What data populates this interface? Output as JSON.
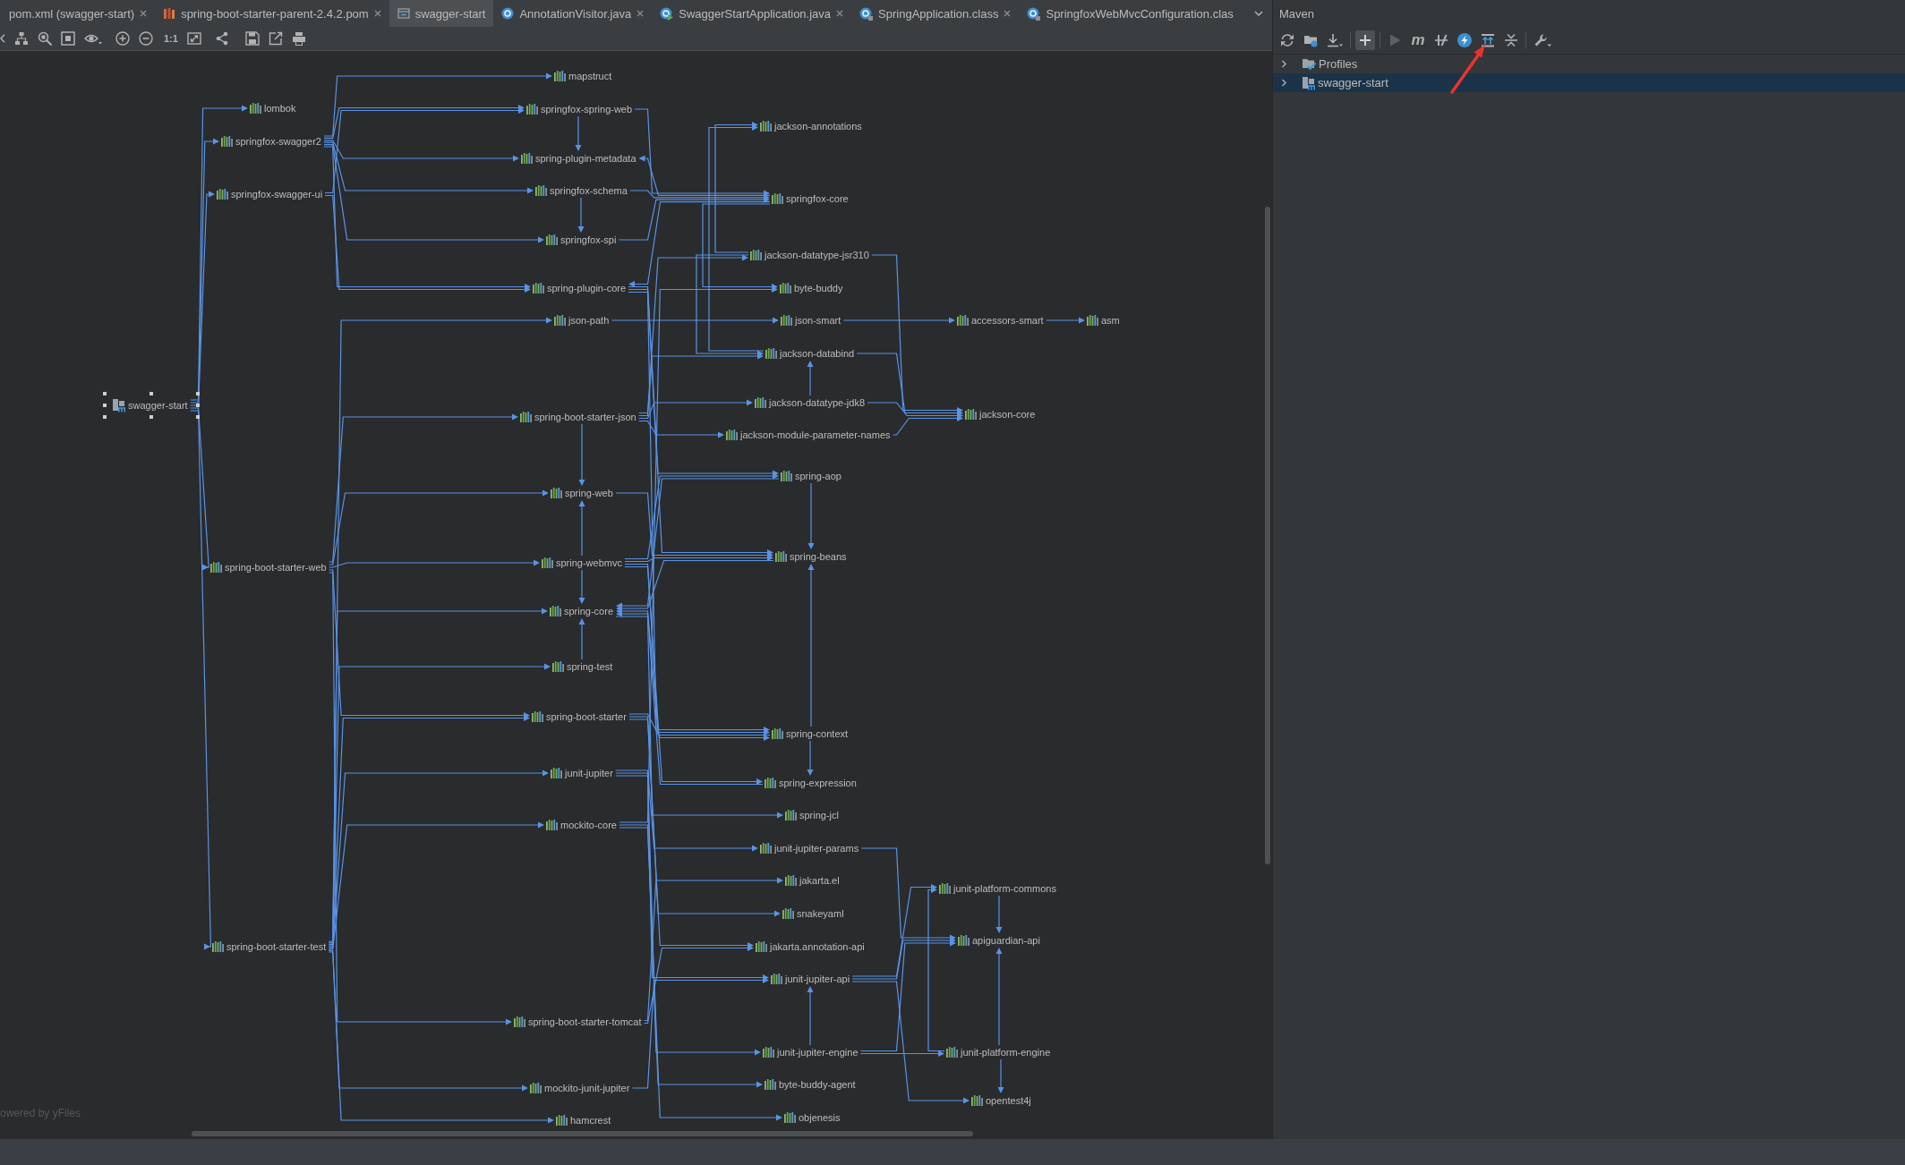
{
  "editor_tabs": [
    {
      "label": "pom.xml (swagger-start)",
      "kind": "plain",
      "selected": false,
      "closable": true
    },
    {
      "label": "spring-boot-starter-parent-2.4.2.pom",
      "kind": "pom",
      "selected": false,
      "closable": true
    },
    {
      "label": "swagger-start",
      "kind": "diagram",
      "selected": true,
      "closable": false
    },
    {
      "label": "AnnotationVisitor.java",
      "kind": "java",
      "selected": false,
      "closable": true
    },
    {
      "label": "SwaggerStartApplication.java",
      "kind": "java-main",
      "selected": false,
      "closable": true
    },
    {
      "label": "SpringApplication.class",
      "kind": "class",
      "selected": false,
      "closable": true
    },
    {
      "label": "SpringfoxWebMvcConfiguration.clas",
      "kind": "class",
      "selected": false,
      "closable": false
    }
  ],
  "diagram_toolbar": {
    "zoom_reset_label": "1:1"
  },
  "diagram": {
    "nodes": [
      {
        "label": "swagger-start",
        "kind": "module",
        "selected": true
      },
      {
        "label": "lombok",
        "kind": "library",
        "selected": false
      },
      {
        "label": "springfox-swagger2",
        "kind": "library",
        "selected": false
      },
      {
        "label": "springfox-swagger-ui",
        "kind": "library",
        "selected": false
      },
      {
        "label": "spring-boot-starter-web",
        "kind": "library",
        "selected": false
      },
      {
        "label": "spring-boot-starter-test",
        "kind": "library",
        "selected": false
      },
      {
        "label": "mapstruct",
        "kind": "library",
        "selected": false
      },
      {
        "label": "springfox-spring-web",
        "kind": "library",
        "selected": false
      },
      {
        "label": "spring-plugin-metadata",
        "kind": "library",
        "selected": false
      },
      {
        "label": "springfox-schema",
        "kind": "library",
        "selected": false
      },
      {
        "label": "springfox-spi",
        "kind": "library",
        "selected": false
      },
      {
        "label": "spring-plugin-core",
        "kind": "library",
        "selected": false
      },
      {
        "label": "json-path",
        "kind": "library",
        "selected": false
      },
      {
        "label": "spring-boot-starter-json",
        "kind": "library",
        "selected": false
      },
      {
        "label": "spring-web",
        "kind": "library",
        "selected": false
      },
      {
        "label": "spring-webmvc",
        "kind": "library",
        "selected": false
      },
      {
        "label": "spring-core",
        "kind": "library",
        "selected": false
      },
      {
        "label": "spring-test",
        "kind": "library",
        "selected": false
      },
      {
        "label": "spring-boot-starter",
        "kind": "library",
        "selected": false
      },
      {
        "label": "junit-jupiter",
        "kind": "library",
        "selected": false
      },
      {
        "label": "mockito-core",
        "kind": "library",
        "selected": false
      },
      {
        "label": "spring-boot-starter-tomcat",
        "kind": "library",
        "selected": false
      },
      {
        "label": "mockito-junit-jupiter",
        "kind": "library",
        "selected": false
      },
      {
        "label": "hamcrest",
        "kind": "library",
        "selected": false
      },
      {
        "label": "jackson-annotations",
        "kind": "library",
        "selected": false
      },
      {
        "label": "springfox-core",
        "kind": "library",
        "selected": false
      },
      {
        "label": "jackson-datatype-jsr310",
        "kind": "library",
        "selected": false
      },
      {
        "label": "byte-buddy",
        "kind": "library",
        "selected": false
      },
      {
        "label": "json-smart",
        "kind": "library",
        "selected": false
      },
      {
        "label": "jackson-databind",
        "kind": "library",
        "selected": false
      },
      {
        "label": "jackson-datatype-jdk8",
        "kind": "library",
        "selected": false
      },
      {
        "label": "jackson-module-parameter-names",
        "kind": "library",
        "selected": false
      },
      {
        "label": "spring-aop",
        "kind": "library",
        "selected": false
      },
      {
        "label": "spring-beans",
        "kind": "library",
        "selected": false
      },
      {
        "label": "spring-context",
        "kind": "library",
        "selected": false
      },
      {
        "label": "spring-expression",
        "kind": "library",
        "selected": false
      },
      {
        "label": "spring-jcl",
        "kind": "library",
        "selected": false
      },
      {
        "label": "junit-jupiter-params",
        "kind": "library",
        "selected": false
      },
      {
        "label": "jakarta.el",
        "kind": "library",
        "selected": false
      },
      {
        "label": "snakeyaml",
        "kind": "library",
        "selected": false
      },
      {
        "label": "jakarta.annotation-api",
        "kind": "library",
        "selected": false
      },
      {
        "label": "junit-jupiter-api",
        "kind": "library",
        "selected": false
      },
      {
        "label": "junit-jupiter-engine",
        "kind": "library",
        "selected": false
      },
      {
        "label": "byte-buddy-agent",
        "kind": "library",
        "selected": false
      },
      {
        "label": "objenesis",
        "kind": "library",
        "selected": false
      },
      {
        "label": "accessors-smart",
        "kind": "library",
        "selected": false
      },
      {
        "label": "jackson-core",
        "kind": "library",
        "selected": false
      },
      {
        "label": "junit-platform-commons",
        "kind": "library",
        "selected": false
      },
      {
        "label": "apiguardian-api",
        "kind": "library",
        "selected": false
      },
      {
        "label": "junit-platform-engine",
        "kind": "library",
        "selected": false
      },
      {
        "label": "opentest4j",
        "kind": "library",
        "selected": false
      },
      {
        "label": "asm",
        "kind": "library",
        "selected": false
      }
    ],
    "footer": "owered by yFiles"
  },
  "maven_panel": {
    "title": "Maven",
    "toolbar": [
      {
        "kind": "refresh",
        "highlighted": false,
        "disabled": false
      },
      {
        "kind": "reimport",
        "highlighted": false,
        "disabled": false
      },
      {
        "kind": "download",
        "highlighted": false,
        "disabled": false
      },
      {
        "kind": "separator"
      },
      {
        "kind": "add",
        "highlighted": true,
        "disabled": false
      },
      {
        "kind": "separator"
      },
      {
        "kind": "run",
        "highlighted": false,
        "disabled": true
      },
      {
        "kind": "goal",
        "label": "m",
        "highlighted": false,
        "disabled": false
      },
      {
        "kind": "offline",
        "highlighted": false,
        "disabled": false
      },
      {
        "kind": "skip-tests",
        "highlighted": false,
        "disabled": false
      },
      {
        "kind": "dependencies",
        "highlighted": false,
        "disabled": false
      },
      {
        "kind": "collapse",
        "highlighted": false,
        "disabled": false
      },
      {
        "kind": "separator"
      },
      {
        "kind": "settings",
        "highlighted": false,
        "disabled": false
      }
    ],
    "tree": [
      {
        "label": "Profiles",
        "kind": "profiles",
        "expanded": false,
        "selected": false
      },
      {
        "label": "swagger-start",
        "kind": "module",
        "expanded": false,
        "selected": true
      }
    ]
  }
}
